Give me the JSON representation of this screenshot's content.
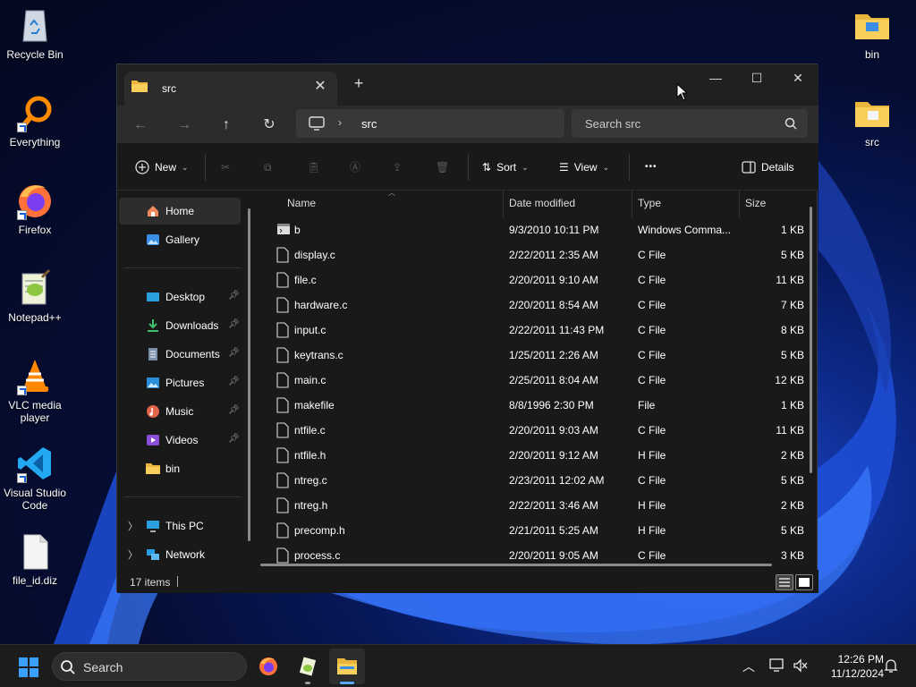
{
  "desktop": {
    "left_icons": [
      {
        "label": "Recycle Bin",
        "icon": "recycle-bin-icon"
      },
      {
        "label": "Everything",
        "icon": "everything-search-icon"
      },
      {
        "label": "Firefox",
        "icon": "firefox-icon"
      },
      {
        "label": "Notepad++",
        "icon": "notepad-plus-plus-icon"
      },
      {
        "label": "VLC media player",
        "icon": "vlc-icon"
      },
      {
        "label": "Visual Studio Code",
        "icon": "vscode-icon"
      },
      {
        "label": "file_id.diz",
        "icon": "file-icon"
      }
    ],
    "right_icons": [
      {
        "label": "bin",
        "icon": "folder-icon"
      },
      {
        "label": "src",
        "icon": "folder-icon"
      }
    ]
  },
  "window": {
    "tab_title": "src",
    "address": {
      "segment": "src"
    },
    "search_placeholder": "Search src",
    "toolbar": {
      "new_label": "New",
      "sort_label": "Sort",
      "view_label": "View",
      "more_label": "•••",
      "details_label": "Details"
    },
    "nav": {
      "home": "Home",
      "gallery": "Gallery",
      "quick": [
        {
          "label": "Desktop",
          "pinned": true
        },
        {
          "label": "Downloads",
          "pinned": true
        },
        {
          "label": "Documents",
          "pinned": true
        },
        {
          "label": "Pictures",
          "pinned": true
        },
        {
          "label": "Music",
          "pinned": true
        },
        {
          "label": "Videos",
          "pinned": true
        },
        {
          "label": "bin",
          "pinned": false
        }
      ],
      "this_pc": "This PC",
      "network": "Network"
    },
    "columns": {
      "name": "Name",
      "date": "Date modified",
      "type": "Type",
      "size": "Size"
    },
    "files": [
      {
        "name": "b",
        "date": "9/3/2010 10:11 PM",
        "type": "Windows Comma...",
        "size": "1 KB"
      },
      {
        "name": "display.c",
        "date": "2/22/2011 2:35 AM",
        "type": "C File",
        "size": "5 KB"
      },
      {
        "name": "file.c",
        "date": "2/20/2011 9:10 AM",
        "type": "C File",
        "size": "11 KB"
      },
      {
        "name": "hardware.c",
        "date": "2/20/2011 8:54 AM",
        "type": "C File",
        "size": "7 KB"
      },
      {
        "name": "input.c",
        "date": "2/22/2011 11:43 PM",
        "type": "C File",
        "size": "8 KB"
      },
      {
        "name": "keytrans.c",
        "date": "1/25/2011 2:26 AM",
        "type": "C File",
        "size": "5 KB"
      },
      {
        "name": "main.c",
        "date": "2/25/2011 8:04 AM",
        "type": "C File",
        "size": "12 KB"
      },
      {
        "name": "makefile",
        "date": "8/8/1996 2:30 PM",
        "type": "File",
        "size": "1 KB"
      },
      {
        "name": "ntfile.c",
        "date": "2/20/2011 9:03 AM",
        "type": "C File",
        "size": "11 KB"
      },
      {
        "name": "ntfile.h",
        "date": "2/20/2011 9:12 AM",
        "type": "H File",
        "size": "2 KB"
      },
      {
        "name": "ntreg.c",
        "date": "2/23/2011 12:02 AM",
        "type": "C File",
        "size": "5 KB"
      },
      {
        "name": "ntreg.h",
        "date": "2/22/2011 3:46 AM",
        "type": "H File",
        "size": "2 KB"
      },
      {
        "name": "precomp.h",
        "date": "2/21/2011 5:25 AM",
        "type": "H File",
        "size": "5 KB"
      },
      {
        "name": "process.c",
        "date": "2/20/2011 9:05 AM",
        "type": "C File",
        "size": "3 KB"
      }
    ],
    "status": {
      "count": "17 items"
    }
  },
  "taskbar": {
    "search_label": "Search",
    "time": "12:26 PM",
    "date": "11/12/2024"
  },
  "colors": {
    "accent": "#5aa9ff",
    "folder": "#f0c14b",
    "window_bg": "#191919"
  }
}
